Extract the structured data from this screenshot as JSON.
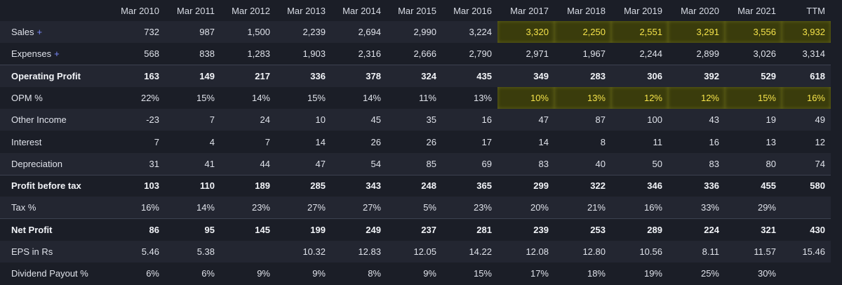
{
  "columns": [
    "",
    "Mar 2010",
    "Mar 2011",
    "Mar 2012",
    "Mar 2013",
    "Mar 2014",
    "Mar 2015",
    "Mar 2016",
    "Mar 2017",
    "Mar 2018",
    "Mar 2019",
    "Mar 2020",
    "Mar 2021",
    "TTM"
  ],
  "expand_symbol": "+",
  "highlight_color": "#f5e34a",
  "rows": [
    {
      "label": "Sales",
      "expandable": true,
      "bold": false,
      "values": [
        "732",
        "987",
        "1,500",
        "2,239",
        "2,694",
        "2,990",
        "3,224",
        "3,320",
        "2,250",
        "2,551",
        "3,291",
        "3,556",
        "3,932"
      ],
      "highlight_from": 7
    },
    {
      "label": "Expenses",
      "expandable": true,
      "bold": false,
      "values": [
        "568",
        "838",
        "1,283",
        "1,903",
        "2,316",
        "2,666",
        "2,790",
        "2,971",
        "1,967",
        "2,244",
        "2,899",
        "3,026",
        "3,314"
      ]
    },
    {
      "label": "Operating Profit",
      "bold": true,
      "values": [
        "163",
        "149",
        "217",
        "336",
        "378",
        "324",
        "435",
        "349",
        "283",
        "306",
        "392",
        "529",
        "618"
      ]
    },
    {
      "label": "OPM %",
      "bold": false,
      "values": [
        "22%",
        "15%",
        "14%",
        "15%",
        "14%",
        "11%",
        "13%",
        "10%",
        "13%",
        "12%",
        "12%",
        "15%",
        "16%"
      ],
      "highlight_from": 7
    },
    {
      "label": "Other Income",
      "bold": false,
      "values": [
        "-23",
        "7",
        "24",
        "10",
        "45",
        "35",
        "16",
        "47",
        "87",
        "100",
        "43",
        "19",
        "49"
      ]
    },
    {
      "label": "Interest",
      "bold": false,
      "values": [
        "7",
        "4",
        "7",
        "14",
        "26",
        "26",
        "17",
        "14",
        "8",
        "11",
        "16",
        "13",
        "12"
      ]
    },
    {
      "label": "Depreciation",
      "bold": false,
      "values": [
        "31",
        "41",
        "44",
        "47",
        "54",
        "85",
        "69",
        "83",
        "40",
        "50",
        "83",
        "80",
        "74"
      ]
    },
    {
      "label": "Profit before tax",
      "bold": true,
      "values": [
        "103",
        "110",
        "189",
        "285",
        "343",
        "248",
        "365",
        "299",
        "322",
        "346",
        "336",
        "455",
        "580"
      ]
    },
    {
      "label": "Tax %",
      "bold": false,
      "values": [
        "16%",
        "14%",
        "23%",
        "27%",
        "27%",
        "5%",
        "23%",
        "20%",
        "21%",
        "16%",
        "33%",
        "29%",
        ""
      ]
    },
    {
      "label": "Net Profit",
      "bold": true,
      "values": [
        "86",
        "95",
        "145",
        "199",
        "249",
        "237",
        "281",
        "239",
        "253",
        "289",
        "224",
        "321",
        "430"
      ]
    },
    {
      "label": "EPS in Rs",
      "bold": false,
      "values": [
        "5.46",
        "5.38",
        "",
        "10.32",
        "12.83",
        "12.05",
        "14.22",
        "12.08",
        "12.80",
        "10.56",
        "8.11",
        "11.57",
        "15.46"
      ]
    },
    {
      "label": "Dividend Payout %",
      "bold": false,
      "values": [
        "6%",
        "6%",
        "9%",
        "9%",
        "8%",
        "9%",
        "15%",
        "17%",
        "18%",
        "19%",
        "25%",
        "30%",
        ""
      ]
    }
  ]
}
